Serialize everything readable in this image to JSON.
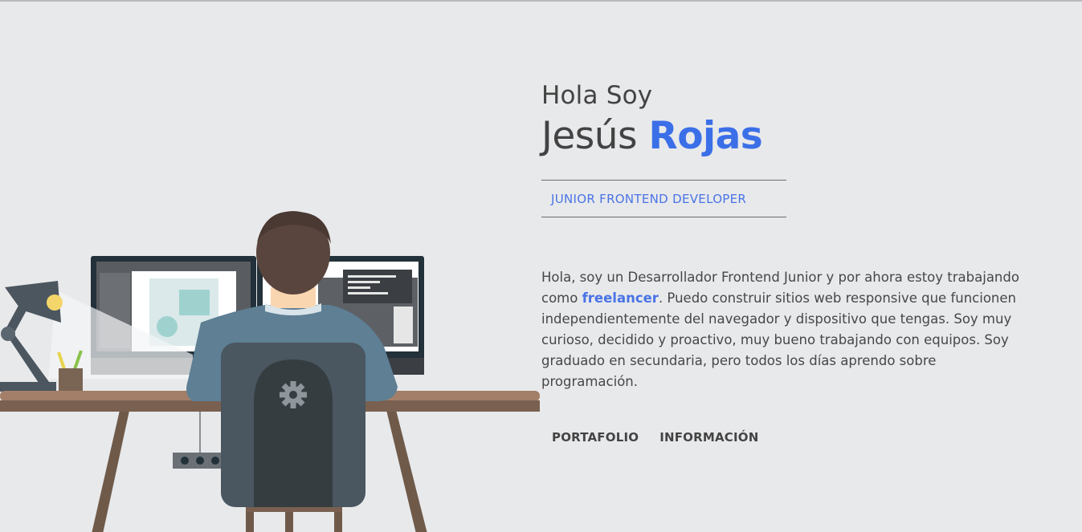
{
  "hero": {
    "greeting": "Hola Soy",
    "first_name": "Jesús",
    "last_name": "Rojas",
    "role": "JUNIOR FRONTEND DEVELOPER",
    "bio_before": "Hola, soy un Desarrollador Frontend Junior y por ahora estoy trabajando como ",
    "bio_highlight": "freelancer",
    "bio_after": ". Puedo construir sitios web responsive que funcionen independientemente del navegador y dispositivo que tengas. Soy muy curioso, decidido y proactivo, muy bueno trabajando con equipos. Soy graduado en secundaria, pero todos los días aprendo sobre programación."
  },
  "nav": {
    "portfolio_label": "PORTAFOLIO",
    "info_label": "INFORMACIÓN"
  },
  "colors": {
    "background": "#e8e9eb",
    "accent": "#3b6fe8",
    "text": "#434343"
  },
  "illustration": {
    "icon": "developer-at-desk-illustration"
  }
}
